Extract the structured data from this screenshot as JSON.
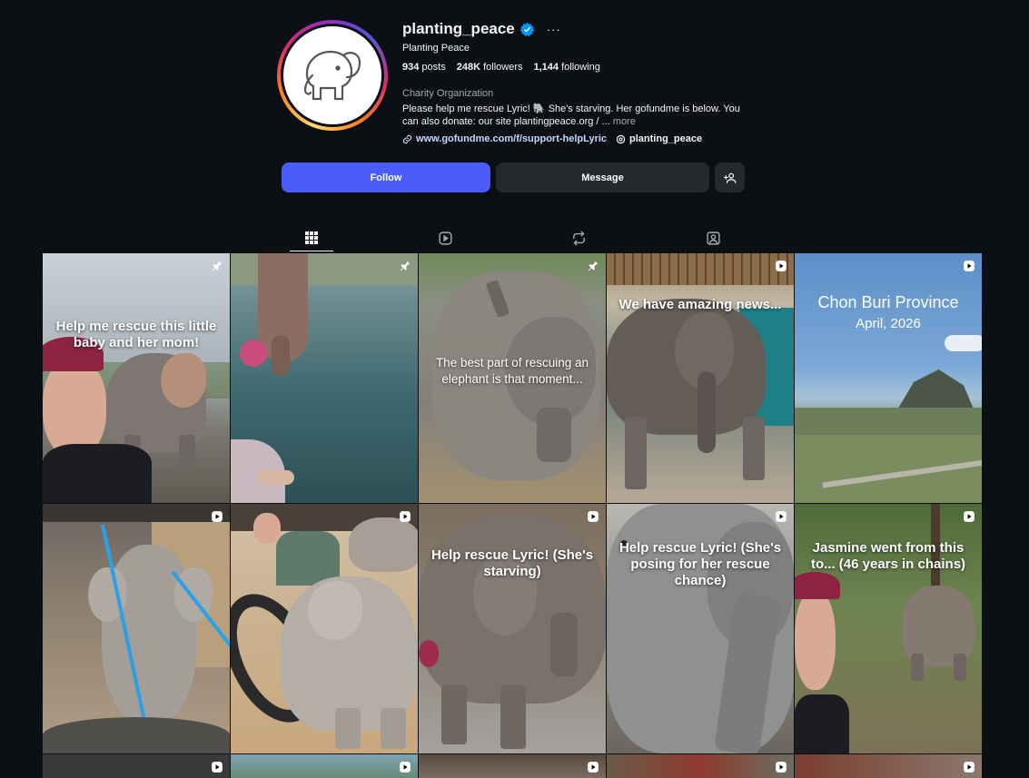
{
  "profile": {
    "username": "planting_peace",
    "full_name": "Planting Peace",
    "posts": "934",
    "posts_label": "posts",
    "followers": "248K",
    "followers_label": "followers",
    "following": "1,144",
    "following_label": "following",
    "category": "Charity Organization",
    "bio": "Please help me rescue Lyric! 🐘 She's starving. Her gofundme is below. You can also donate: our site plantingpeace.org / ...",
    "bio_more": "more",
    "link": "www.gofundme.com/f/support-helpLyric",
    "threads_handle": "planting_peace"
  },
  "actions": {
    "follow": "Follow",
    "message": "Message"
  },
  "tabs": [
    "posts",
    "reels",
    "reposts",
    "tagged"
  ],
  "posts": [
    {
      "text": "Help me rescue this little baby and her mom!",
      "badge": "pin"
    },
    {
      "text": "",
      "badge": "pin"
    },
    {
      "text": "The best part of rescuing an elephant is that moment...",
      "badge": "pin"
    },
    {
      "text": "We have amazing news...",
      "badge": "reel"
    },
    {
      "text": "Chon Buri Province",
      "subtext": "April, 2026",
      "badge": "reel"
    },
    {
      "text": "",
      "badge": "reel"
    },
    {
      "text": "",
      "badge": "reel"
    },
    {
      "text": "Help rescue Lyric! (She's starving)",
      "badge": "reel"
    },
    {
      "text": "Help rescue Lyric! (She's posing for her rescue chance)",
      "badge": "reel"
    },
    {
      "text": "Jasmine went from this to... (46 years in chains)",
      "badge": "reel"
    }
  ],
  "colors": {
    "background": "#0c1014",
    "follow_button": "#4a5df9",
    "secondary_button": "#25292e",
    "verified": "#0095f6"
  }
}
